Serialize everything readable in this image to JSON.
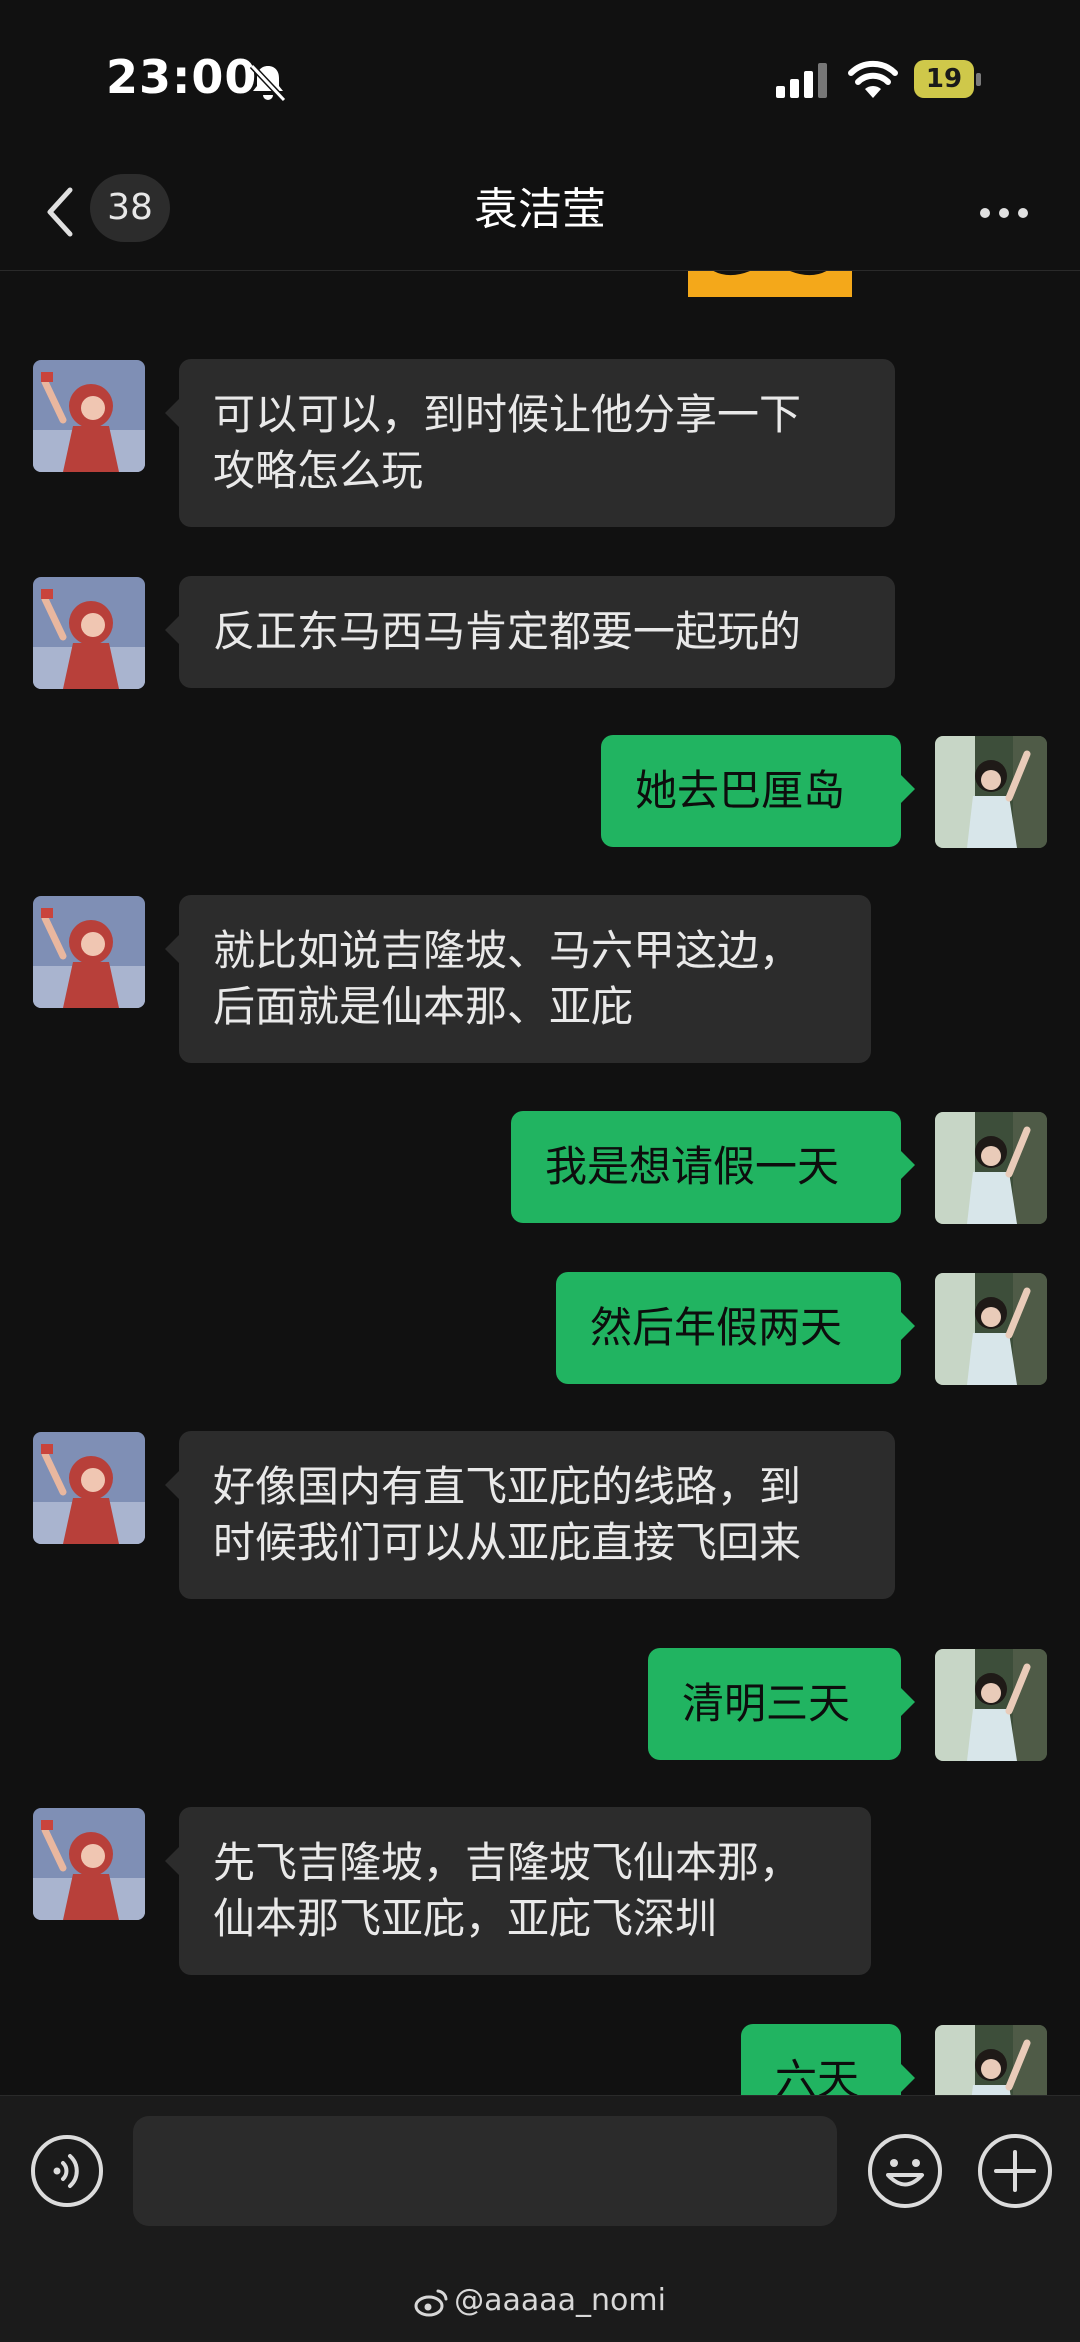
{
  "status_bar": {
    "time": "23:00",
    "battery": "19"
  },
  "nav": {
    "unread_count": "38",
    "title": "袁洁莹"
  },
  "messages": [
    {
      "side": "in",
      "lines": [
        "可以可以，到时候让他分享一下",
        "攻略怎么玩"
      ]
    },
    {
      "side": "in",
      "lines": [
        "反正东马西马肯定都要一起玩的"
      ]
    },
    {
      "side": "out",
      "lines": [
        "她去巴厘岛"
      ]
    },
    {
      "side": "in",
      "lines": [
        "就比如说吉隆坡、马六甲这边，",
        "后面就是仙本那、亚庇"
      ]
    },
    {
      "side": "out",
      "lines": [
        "我是想请假一天"
      ]
    },
    {
      "side": "out",
      "lines": [
        "然后年假两天"
      ]
    },
    {
      "side": "in",
      "lines": [
        "好像国内有直飞亚庇的线路，到",
        "时候我们可以从亚庇直接飞回来"
      ]
    },
    {
      "side": "out",
      "lines": [
        "清明三天"
      ]
    },
    {
      "side": "in",
      "lines": [
        "先飞吉隆坡，吉隆坡飞仙本那，",
        "仙本那飞亚庇，亚庇飞深圳"
      ]
    },
    {
      "side": "out",
      "lines": [
        "六天"
      ]
    }
  ],
  "watermark": "@aaaaa_nomi",
  "colors": {
    "background": "#111111",
    "incoming_bubble": "#2c2c2c",
    "outgoing_bubble": "#21b461"
  }
}
